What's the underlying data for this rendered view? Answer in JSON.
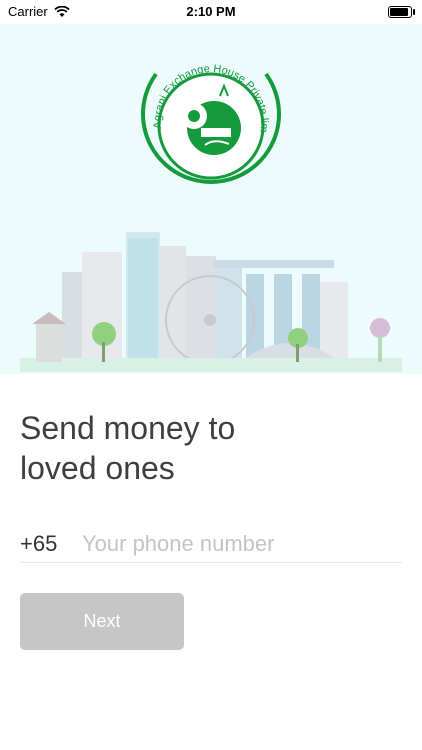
{
  "status_bar": {
    "carrier": "Carrier",
    "time": "2:10 PM",
    "battery_level": 0.9
  },
  "logo": {
    "text": "Agrani Exchange House Private limited"
  },
  "content": {
    "headline_line1": "Send money to",
    "headline_line2": "loved ones",
    "country_code": "+65",
    "phone_placeholder": "Your phone number",
    "next_label": "Next"
  },
  "colors": {
    "brand_green": "#159a3c",
    "hero_bg": "#ecfbfb",
    "button_disabled": "#c6c6c6"
  }
}
